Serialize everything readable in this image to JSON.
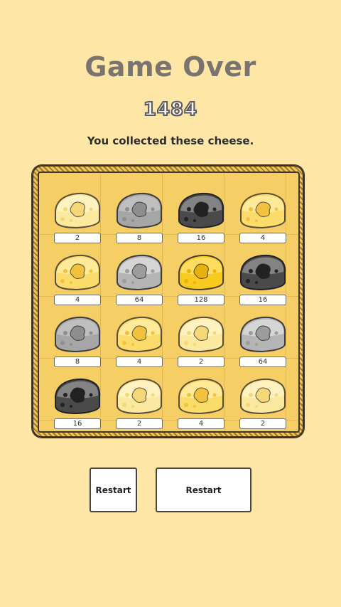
{
  "header": {
    "title": "Game Over",
    "score": "1484",
    "subtitle": "You collected these cheese."
  },
  "tiles": [
    {
      "value": "2",
      "kind": "pale-yellow"
    },
    {
      "value": "8",
      "kind": "grey-speckled"
    },
    {
      "value": "16",
      "kind": "dark"
    },
    {
      "value": "4",
      "kind": "yellow"
    },
    {
      "value": "4",
      "kind": "yellow"
    },
    {
      "value": "64",
      "kind": "silver"
    },
    {
      "value": "128",
      "kind": "gold"
    },
    {
      "value": "16",
      "kind": "dark"
    },
    {
      "value": "8",
      "kind": "grey-speckled"
    },
    {
      "value": "4",
      "kind": "yellow"
    },
    {
      "value": "2",
      "kind": "pale-yellow"
    },
    {
      "value": "64",
      "kind": "silver"
    },
    {
      "value": "16",
      "kind": "dark"
    },
    {
      "value": "2",
      "kind": "pale-yellow"
    },
    {
      "value": "4",
      "kind": "yellow"
    },
    {
      "value": "2",
      "kind": "pale-yellow"
    }
  ],
  "buttons": {
    "restart_small": "Restart",
    "restart_large": "Restart"
  },
  "colors": {
    "background": "#fde6a6",
    "board": "#f6ce66",
    "title": "#7a7471"
  }
}
